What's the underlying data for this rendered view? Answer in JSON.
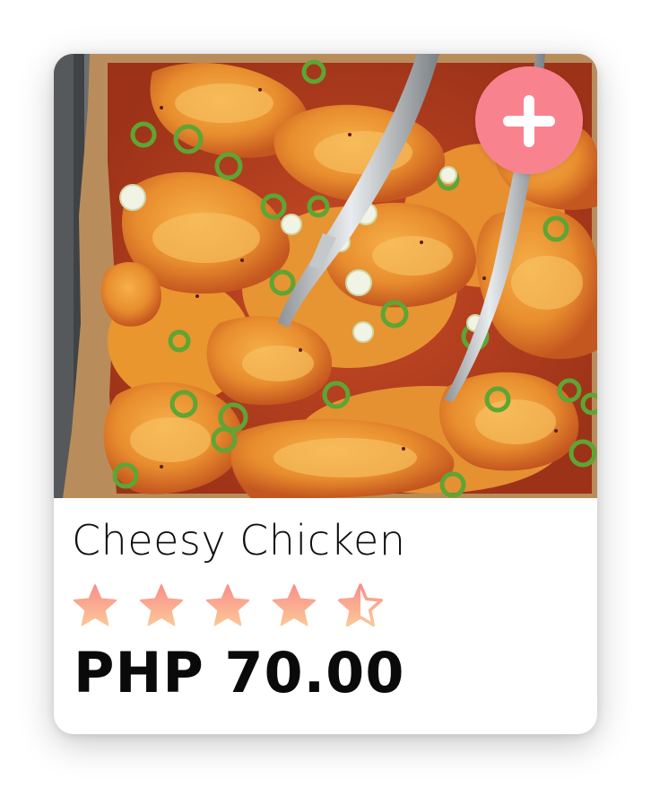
{
  "product": {
    "name": "Cheesy Chicken",
    "price": "PHP 70.00",
    "rating": 4.5,
    "rating_max": 5
  },
  "add_button": {
    "icon": "plus-icon",
    "color": "#f8838f"
  },
  "colors": {
    "star_gradient_top": "#f98f8c",
    "star_gradient_bottom": "#fbc796",
    "card_background": "#ffffff",
    "text": "#111111"
  }
}
